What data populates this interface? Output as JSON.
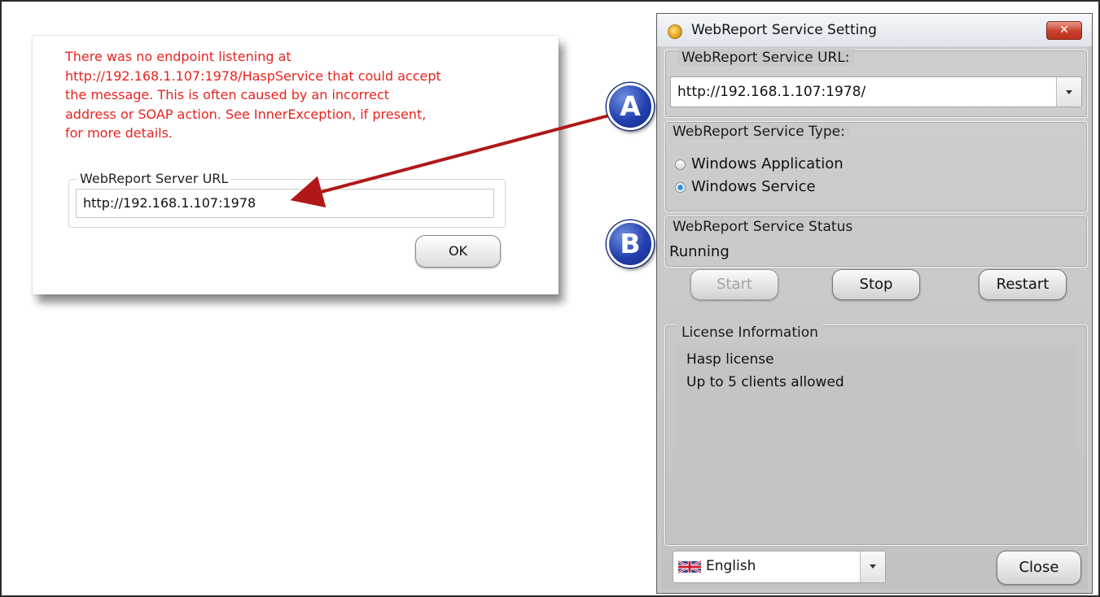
{
  "error_dialog": {
    "message_lines": [
      "There was no endpoint listening at",
      "http://192.168.1.107:1978/HaspService that could accept",
      "the message. This is often caused by an incorrect",
      "address or SOAP action. See InnerException, if present,",
      "for more details."
    ],
    "group_label": "WebReport Server URL",
    "url_value": "http://192.168.1.107:1978",
    "ok_label": "OK"
  },
  "callouts": {
    "a": "A",
    "b": "B"
  },
  "window": {
    "title": "WebReport Service Setting",
    "close_glyph": "✕",
    "url_group": {
      "label": "WebReport Service URL:",
      "value": "http://192.168.1.107:1978/"
    },
    "type_group": {
      "label": "WebReport Service Type:",
      "options": [
        {
          "label": "Windows Application",
          "selected": false
        },
        {
          "label": "Windows Service",
          "selected": true
        }
      ]
    },
    "status_group": {
      "label": "WebReport Service Status",
      "value": "Running"
    },
    "buttons": {
      "start": "Start",
      "stop": "Stop",
      "restart": "Restart"
    },
    "license_group": {
      "label": "License Information",
      "lines": [
        "Hasp license",
        "Up to 5 clients allowed"
      ]
    },
    "language": {
      "selected": "English",
      "flag": "uk-flag-icon"
    },
    "close_label": "Close"
  },
  "colors": {
    "error_text": "#e8231f",
    "arrow": "#b01818",
    "badge": "#2440b0"
  }
}
